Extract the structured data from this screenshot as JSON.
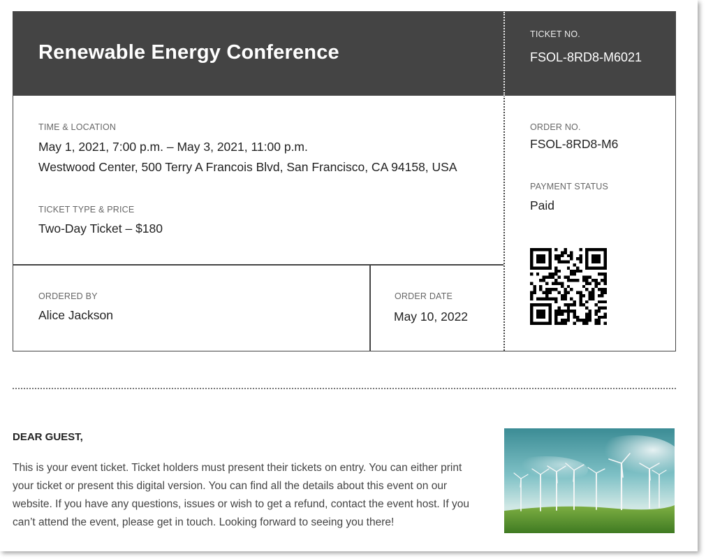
{
  "event": {
    "title": "Renewable Energy Conference"
  },
  "ticket_number": {
    "label": "TICKET NO.",
    "value": "FSOL-8RD8-M6021"
  },
  "time_location": {
    "label": "TIME & LOCATION",
    "datetime": "May 1, 2021, 7:00 p.m. – May 3, 2021, 11:00 p.m.",
    "address": "Westwood Center, 500 Terry A Francois Blvd, San Francisco, CA 94158, USA"
  },
  "ticket_type": {
    "label": "TICKET TYPE & PRICE",
    "value": "Two-Day Ticket – $180"
  },
  "ordered_by": {
    "label": "ORDERED BY",
    "value": "Alice Jackson"
  },
  "order_date": {
    "label": "ORDER DATE",
    "value": "May 10, 2022"
  },
  "order_number": {
    "label": "ORDER NO.",
    "value": "FSOL-8RD8-M6"
  },
  "payment_status": {
    "label": "PAYMENT STATUS",
    "value": "Paid"
  },
  "qr_code": {
    "icon": "qr-code-icon"
  },
  "letter": {
    "greeting": "DEAR GUEST,",
    "body": "This is your event ticket. Ticket holders must present their tickets on entry. You can either print your ticket or present this digital version. You can find all the details about this event on our website. If you have any questions, issues or wish to get a refund, contact the event host. If you can’t attend the event, please get in touch. Looking forward to seeing you there!"
  },
  "colors": {
    "header_bg": "#444444",
    "header_text": "#ffffff",
    "border": "#444444"
  }
}
